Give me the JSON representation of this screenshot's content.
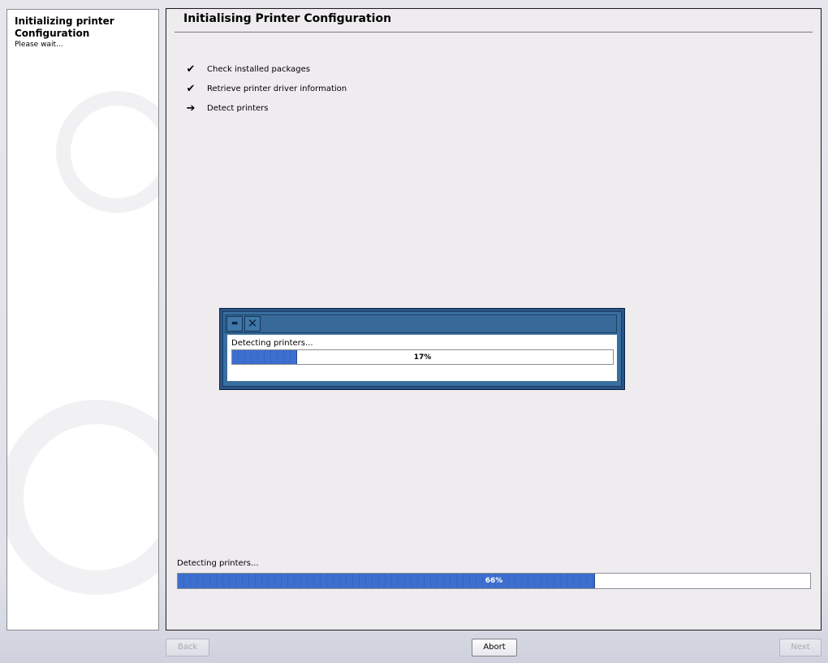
{
  "sidebar": {
    "title": "Initializing printer Configuration",
    "text": "Please wait..."
  },
  "main": {
    "title": "Initialising Printer Configuration",
    "steps": [
      {
        "icon": "check-icon",
        "glyph": "✔",
        "label": "Check installed packages",
        "status": "done"
      },
      {
        "icon": "check-icon",
        "glyph": "✔",
        "label": "Retrieve printer driver information",
        "status": "done"
      },
      {
        "icon": "arrow-right-icon",
        "glyph": "➔",
        "label": "Detect printers",
        "status": "current"
      }
    ],
    "overall_progress": {
      "label": "Detecting printers...",
      "percent_text": "66%",
      "value": 0.66
    }
  },
  "popup": {
    "minimize_glyph": "▬",
    "close_glyph": "✕",
    "label": "Detecting printers...",
    "percent_text": "17%",
    "value": 0.17
  },
  "buttons": {
    "back": "Back",
    "abort": "Abort",
    "next": "Next"
  },
  "colors": {
    "progress_fill": "#3d6fcf",
    "popup_frame": "#386f9f"
  }
}
